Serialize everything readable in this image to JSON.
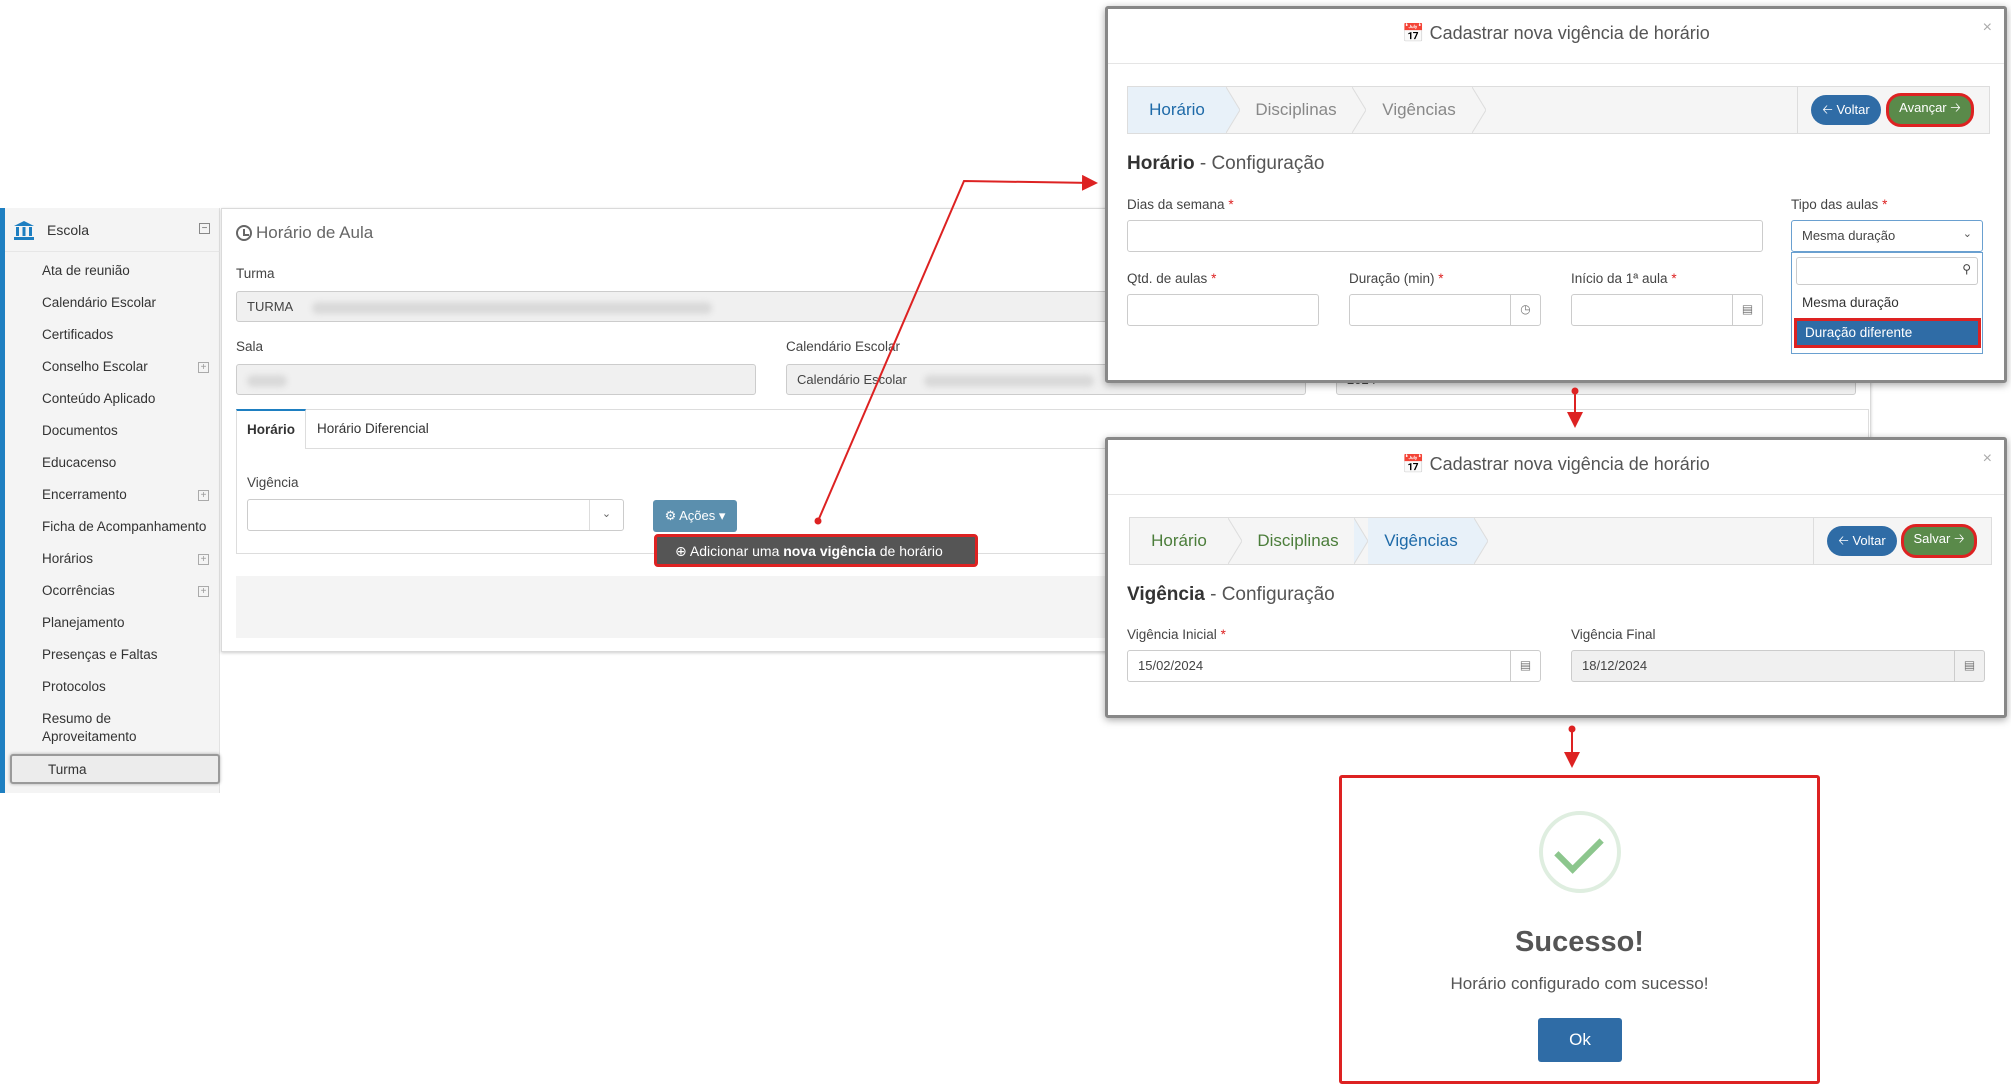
{
  "sidebar": {
    "header": "Escola",
    "items": [
      {
        "label": "Ata de reunião"
      },
      {
        "label": "Calendário Escolar"
      },
      {
        "label": "Certificados"
      },
      {
        "label": "Conselho Escolar"
      },
      {
        "label": "Conteúdo Aplicado"
      },
      {
        "label": "Documentos"
      },
      {
        "label": "Educacenso"
      },
      {
        "label": "Encerramento"
      },
      {
        "label": "Ficha de Acompanhamento"
      },
      {
        "label": "Horários"
      },
      {
        "label": "Ocorrências"
      },
      {
        "label": "Planejamento"
      },
      {
        "label": "Presenças e Faltas"
      },
      {
        "label": "Protocolos"
      },
      {
        "label": "Resumo de Aproveitamento"
      },
      {
        "label": "Turma"
      }
    ]
  },
  "main": {
    "title": "Horário de Aula",
    "turma_label": "Turma",
    "turma_value": "TURMA",
    "sala_label": "Sala",
    "calendario_label": "Calendário Escolar",
    "calendario_value": "Calendário Escolar",
    "ano_value": "2024",
    "tabs": [
      {
        "label": "Horário"
      },
      {
        "label": "Horário Diferencial"
      }
    ],
    "vigencia_label": "Vigência",
    "acoes_label": "Ações",
    "menu_add_prefix": "Adicionar uma",
    "menu_add_bold": "nova vigência",
    "menu_add_suffix": "de horário"
  },
  "modal1": {
    "title": "Cadastrar nova vigência de horário",
    "close": "×",
    "steps": [
      {
        "label": "Horário"
      },
      {
        "label": "Disciplinas"
      },
      {
        "label": "Vigências"
      }
    ],
    "btn_back": "Voltar",
    "btn_next": "Avançar",
    "section_bold": "Horário",
    "section_rest": "- Configuração",
    "dias_label": "Dias da semana",
    "tipo_label": "Tipo das aulas",
    "tipo_value": "Mesma duração",
    "qtd_label": "Qtd. de aulas",
    "duracao_label": "Duração (min)",
    "inicio_label": "Início da 1ª aula",
    "options": [
      {
        "label": "Mesma duração"
      },
      {
        "label": "Duração diferente"
      }
    ]
  },
  "modal2": {
    "title": "Cadastrar nova vigência de horário",
    "close": "×",
    "steps": [
      {
        "label": "Horário"
      },
      {
        "label": "Disciplinas"
      },
      {
        "label": "Vigências"
      }
    ],
    "btn_back": "Voltar",
    "btn_save": "Salvar",
    "section_bold": "Vigência",
    "section_rest": "- Configuração",
    "inicial_label": "Vigência Inicial",
    "inicial_value": "15/02/2024",
    "final_label": "Vigência Final",
    "final_value": "18/12/2024"
  },
  "success": {
    "title": "Sucesso!",
    "message": "Horário configurado com sucesso!",
    "ok": "Ok"
  },
  "required_mark": "*",
  "colors": {
    "accent": "#1e7fc1",
    "primary_button": "#2f6ca6",
    "success_button": "#5a8a4a",
    "highlight": "#dd2222"
  }
}
